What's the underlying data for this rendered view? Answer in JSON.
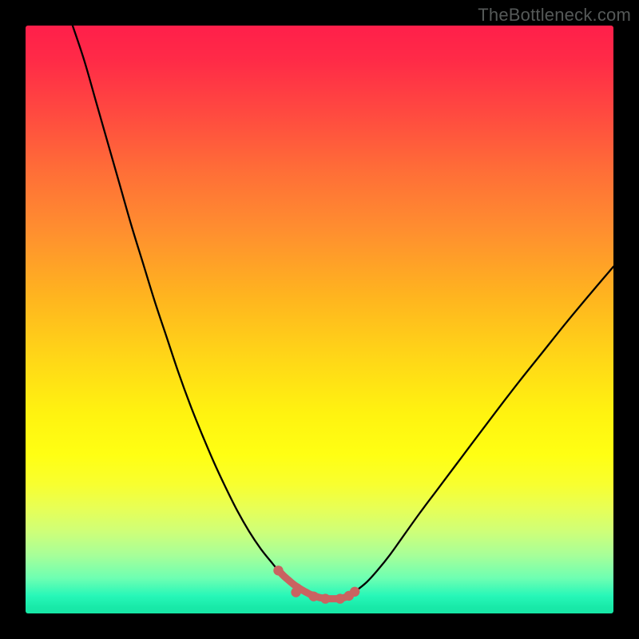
{
  "attribution": "TheBottleneck.com",
  "colors": {
    "frame": "#000000",
    "curve": "#000000",
    "highlight_stroke": "#c96361",
    "highlight_dot": "#c96361"
  },
  "chart_data": {
    "type": "line",
    "title": "",
    "xlabel": "",
    "ylabel": "",
    "xlim": [
      0,
      100
    ],
    "ylim": [
      0,
      100
    ],
    "x": [
      8,
      10,
      12,
      14,
      16,
      18,
      20,
      22,
      24,
      26,
      28,
      30,
      32,
      34,
      36,
      38,
      40,
      42,
      43,
      44,
      45.5,
      47,
      48.5,
      50,
      51.5,
      53,
      54,
      55,
      56,
      58,
      60,
      62,
      64,
      67,
      70,
      73,
      76,
      80,
      84,
      88,
      92,
      96,
      100
    ],
    "values": [
      100,
      94,
      87,
      80,
      73,
      66,
      59.5,
      53,
      47,
      41,
      35.5,
      30.5,
      25.8,
      21.5,
      17.5,
      14,
      11,
      8.5,
      7.3,
      6.3,
      5,
      4,
      3.2,
      2.7,
      2.5,
      2.5,
      2.6,
      3,
      3.7,
      5.3,
      7.5,
      10,
      12.8,
      17,
      21,
      25,
      29,
      34.3,
      39.5,
      44.5,
      49.5,
      54.3,
      59
    ],
    "highlight_region": {
      "x_start": 43,
      "x_end": 56,
      "dots_x": [
        43,
        46,
        49,
        51,
        53.5,
        55,
        56
      ],
      "dots_y": [
        7.3,
        3.6,
        2.9,
        2.5,
        2.5,
        3,
        3.7
      ]
    }
  }
}
